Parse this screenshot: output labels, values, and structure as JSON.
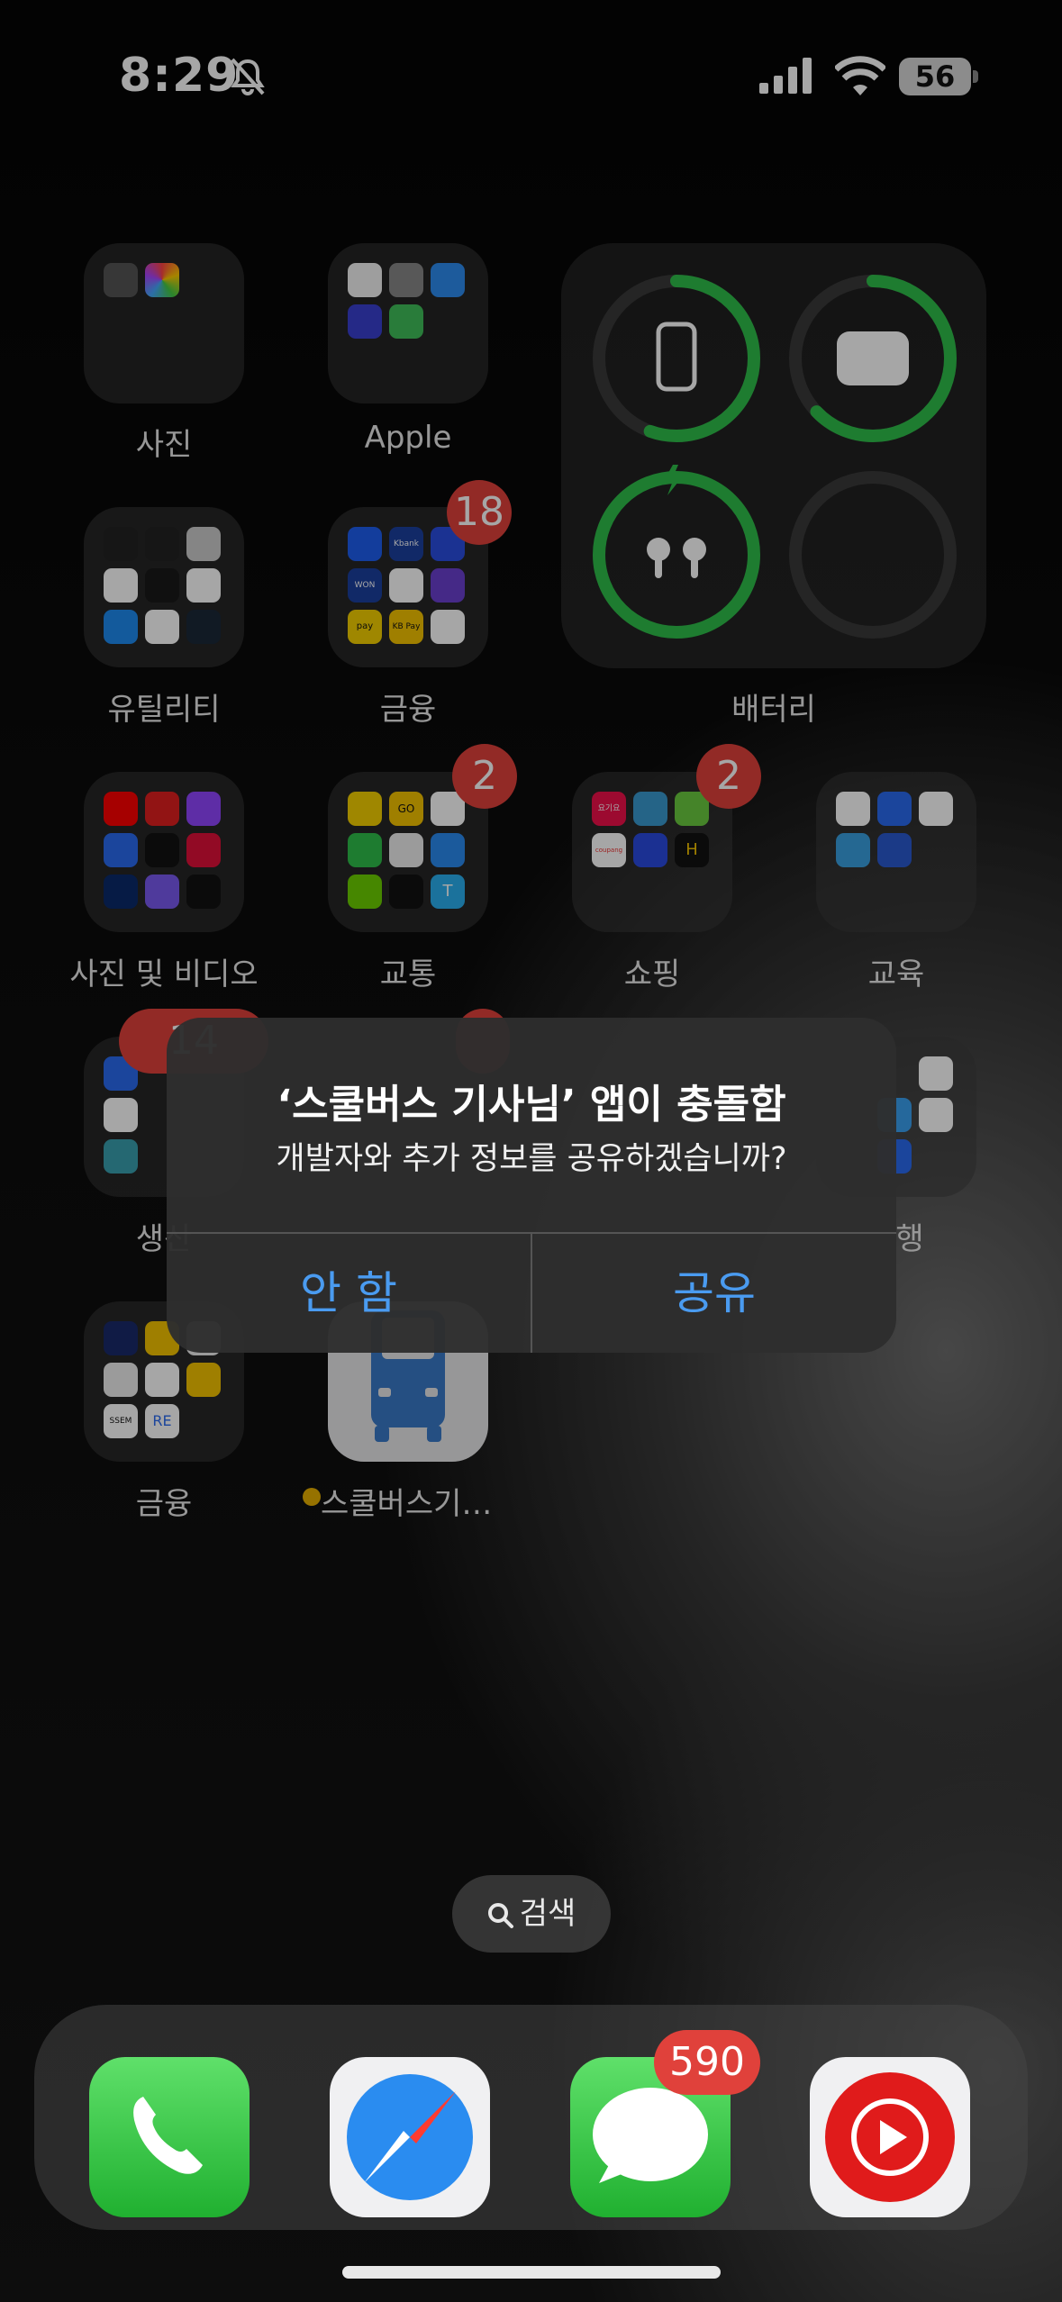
{
  "status_bar": {
    "time": "8:29",
    "battery": "56"
  },
  "folders": {
    "photos": {
      "label": "사진"
    },
    "apple": {
      "label": "Apple"
    },
    "utilities": {
      "label": "유틸리티"
    },
    "finance1": {
      "label": "금융",
      "badge": "18"
    },
    "photo_video": {
      "label": "사진 및 비디오"
    },
    "transport": {
      "label": "교통",
      "badge": "2"
    },
    "shopping": {
      "label": "쇼핑",
      "badge": "2"
    },
    "education": {
      "label": "교육"
    },
    "productivity": {
      "label": "생산",
      "badge": "14"
    },
    "travel": {
      "label": "행"
    },
    "finance2": {
      "label": "금융"
    }
  },
  "widget": {
    "label": "배터리"
  },
  "app_school_bus": {
    "label": "스쿨버스기…"
  },
  "alert": {
    "title": "‘스쿨버스 기사님’ 앱이 충돌함",
    "message": "개발자와 추가 정보를 공유하겠습니까?",
    "cancel_label": "안 함",
    "share_label": "공유"
  },
  "search": {
    "label": "검색"
  },
  "dock": {
    "messages_badge": "590"
  },
  "mini_text": {
    "kbank": "Kbank",
    "won": "WON",
    "pay": "pay",
    "kb": "KB Pay",
    "go": "GO",
    "yogiyo": "요기요",
    "coupang": "coupang",
    "h": "H",
    "tmoney": "T",
    "re": "RE",
    "sscm": "SSEM"
  },
  "colors": {
    "accent_blue": "#4a9bf0",
    "badge_red": "#e0413b",
    "ring_green": "#2fbf4a"
  }
}
